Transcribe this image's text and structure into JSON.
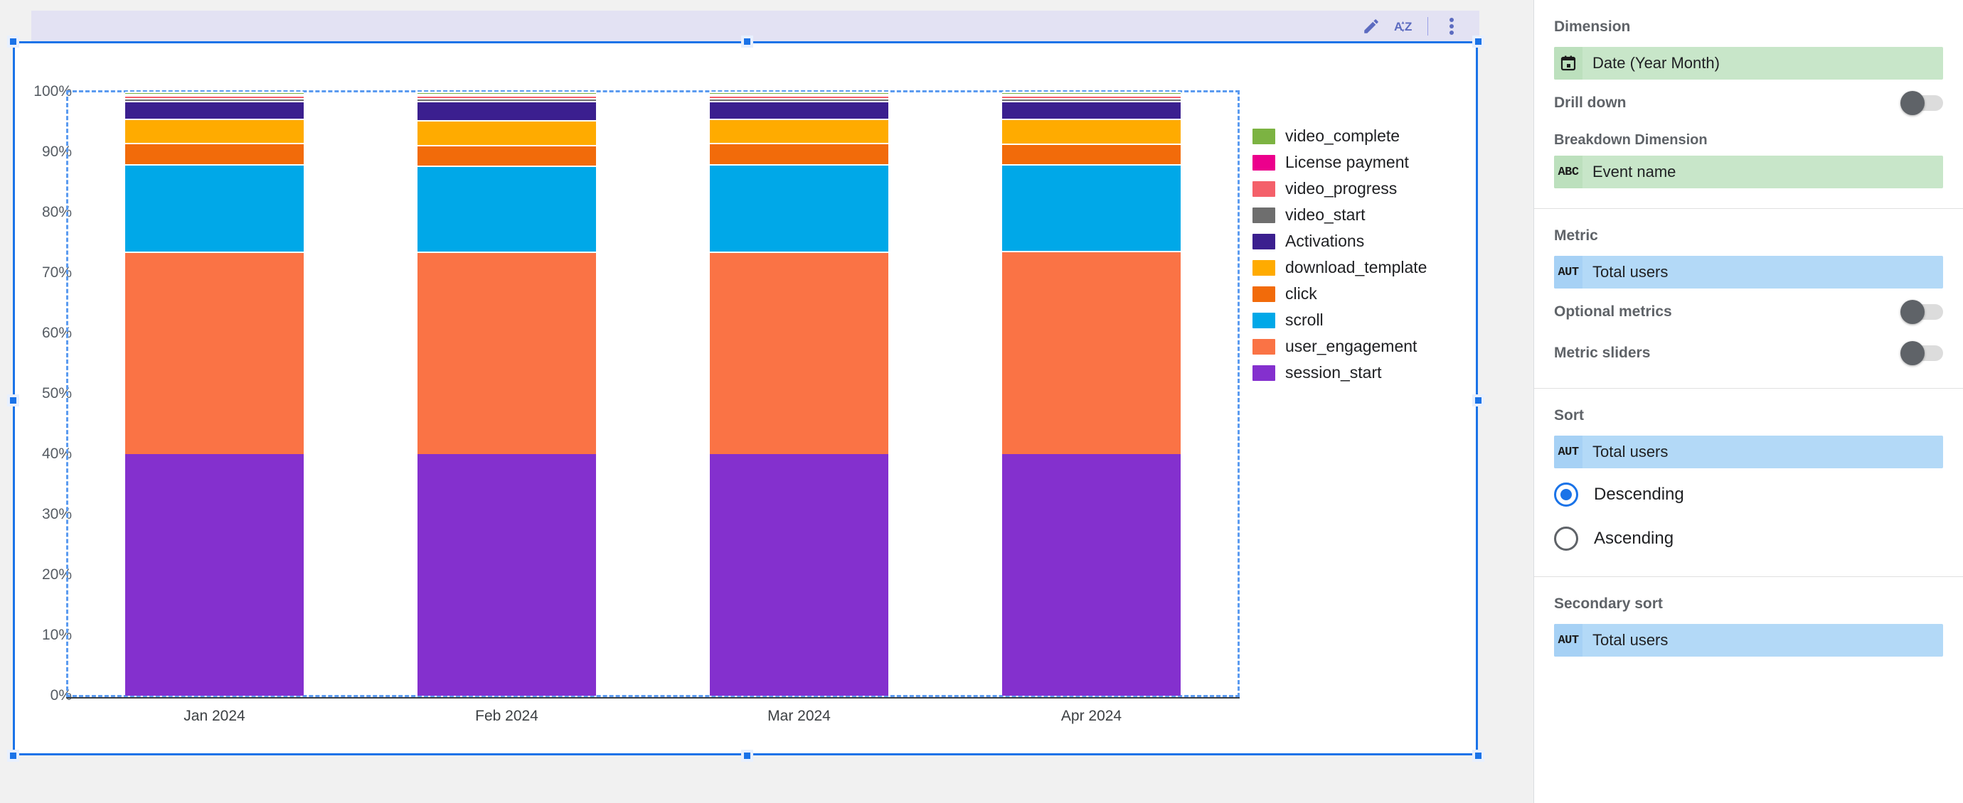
{
  "toolbar": {
    "edit_label": "Edit",
    "sort_label": "Sort",
    "more_label": "More options",
    "icons": [
      "pencil-icon",
      "sort-az-icon",
      "more-vert-icon"
    ],
    "accent_color": "#5c6bc0",
    "background_color": "#e3e2f3"
  },
  "chart": {
    "selected": true,
    "selection_color": "#1a73e8"
  },
  "chart_data": {
    "type": "bar",
    "stacked": true,
    "normalized": true,
    "title": "",
    "xlabel": "",
    "ylabel": "",
    "ylim": [
      0,
      100
    ],
    "y_tick_labels": [
      "0%",
      "10%",
      "20%",
      "30%",
      "40%",
      "50%",
      "60%",
      "70%",
      "80%",
      "90%",
      "100%"
    ],
    "y_tick_values": [
      0,
      10,
      20,
      30,
      40,
      50,
      60,
      70,
      80,
      90,
      100
    ],
    "grid": false,
    "legend_position": "right",
    "categories": [
      "Jan 2024",
      "Feb 2024",
      "Mar 2024",
      "Apr 2024"
    ],
    "series": [
      {
        "name": "video_complete",
        "color": "#7cb342",
        "values": [
          0.3,
          0.3,
          0.3,
          0.3
        ]
      },
      {
        "name": "License payment",
        "color": "#ec008c",
        "values": [
          0.3,
          0.3,
          0.3,
          0.3
        ]
      },
      {
        "name": "video_progress",
        "color": "#f4606a",
        "values": [
          0.5,
          0.5,
          0.5,
          0.5
        ]
      },
      {
        "name": "video_start",
        "color": "#6e6e6e",
        "values": [
          0.4,
          0.4,
          0.4,
          0.4
        ]
      },
      {
        "name": "Activations",
        "color": "#3b1f8f",
        "values": [
          3.0,
          3.2,
          3.0,
          3.0
        ]
      },
      {
        "name": "download_template",
        "color": "#ffab00",
        "values": [
          4.0,
          4.1,
          4.0,
          4.1
        ]
      },
      {
        "name": "click",
        "color": "#f26b0a",
        "values": [
          3.5,
          3.4,
          3.5,
          3.4
        ]
      },
      {
        "name": "scroll",
        "color": "#00a8e8",
        "values": [
          14.5,
          14.3,
          14.5,
          14.4
        ]
      },
      {
        "name": "user_engagement",
        "color": "#fa7345",
        "values": [
          33.5,
          33.5,
          33.5,
          33.6
        ]
      },
      {
        "name": "session_start",
        "color": "#8430ce",
        "values": [
          40.0,
          40.0,
          40.0,
          40.0
        ]
      }
    ]
  },
  "panel": {
    "dimension": {
      "title": "Dimension",
      "chip_icon": "calendar-icon",
      "chip_value": "Date (Year Month)",
      "drill_down_label": "Drill down",
      "drill_down_on": false,
      "breakdown_title": "Breakdown Dimension",
      "breakdown_icon": "ABC",
      "breakdown_value": "Event name"
    },
    "metric": {
      "title": "Metric",
      "chip_icon": "AUT",
      "chip_value": "Total users",
      "optional_metrics_label": "Optional metrics",
      "optional_metrics_on": false,
      "metric_sliders_label": "Metric sliders",
      "metric_sliders_on": false
    },
    "sort": {
      "title": "Sort",
      "chip_icon": "AUT",
      "chip_value": "Total users",
      "descending_label": "Descending",
      "ascending_label": "Ascending",
      "selected": "Descending"
    },
    "secondary_sort": {
      "title": "Secondary sort",
      "chip_icon": "AUT",
      "chip_value": "Total users"
    }
  }
}
